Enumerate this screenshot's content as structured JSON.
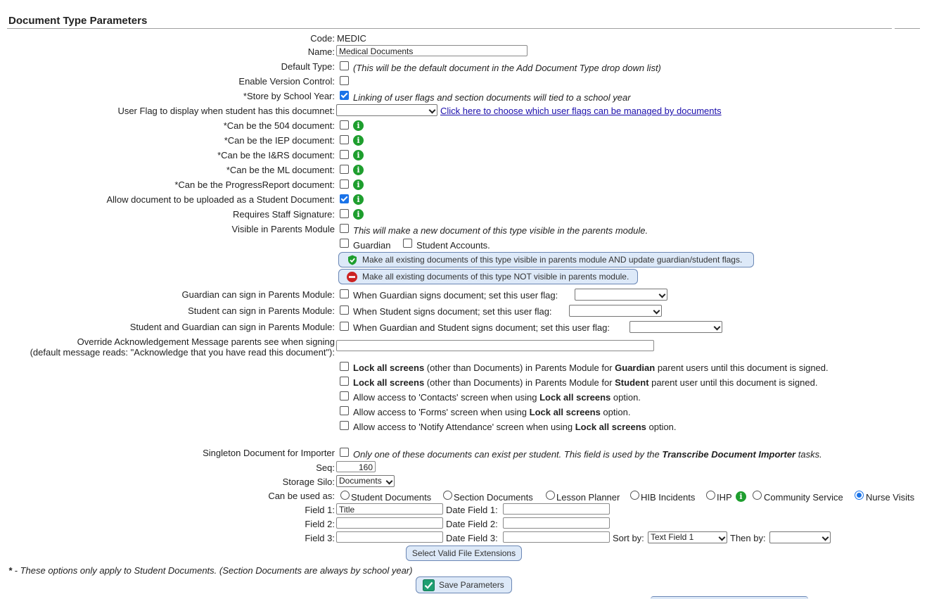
{
  "page_title": "Document Type Parameters",
  "code": {
    "label": "Code:",
    "value": "MEDIC"
  },
  "name": {
    "label": "Name:",
    "value": "Medical Documents"
  },
  "default_type": {
    "label": "Default Type:",
    "note": "(This will be the default document in the Add Document Type drop down list)",
    "checked": false
  },
  "version_control": {
    "label": "Enable Version Control:",
    "checked": false
  },
  "school_year": {
    "label": "*Store by School Year:",
    "note": "Linking of user flags and section documents will tied to a school year",
    "checked": true
  },
  "user_flag": {
    "label": "User Flag to display when student has this documnet:",
    "value": "",
    "link": "Click here to choose which user flags can be managed by documents"
  },
  "options": [
    {
      "label": "*Can be the 504 document:",
      "checked": false
    },
    {
      "label": "*Can be the IEP document:",
      "checked": false
    },
    {
      "label": "*Can be the I&RS document:",
      "checked": false
    },
    {
      "label": "*Can be the ML document:",
      "checked": false
    },
    {
      "label": "*Can be the ProgressReport document:",
      "checked": false
    },
    {
      "label": "Allow document to be uploaded as a Student Document:",
      "checked": true
    },
    {
      "label": "Requires Staff Signature:",
      "checked": false
    }
  ],
  "parents_module": {
    "label": "Visible in Parents Module",
    "note": "This will make a new document of this type visible in the parents module.",
    "guardian": "Guardian",
    "student_accounts": "Student Accounts.",
    "make_visible": "Make all existing documents of this type visible in parents module AND update guardian/student flags.",
    "make_not_visible": "Make all existing documents of this type NOT visible in parents module."
  },
  "signing": [
    {
      "label": "Guardian can sign in Parents Module:",
      "text": "When Guardian signs document; set this user flag:"
    },
    {
      "label": "Student can sign in Parents Module:",
      "text": "When Student signs document; set this user flag:"
    },
    {
      "label": "Student and Guardian can sign in Parents Module:",
      "text": "When Guardian and Student signs document; set this user flag:"
    }
  ],
  "override": {
    "label1": "Override Acknowledgement Message parents see when signing",
    "label2": "(default message reads: \"Acknowledge that you have read this document\"):",
    "value": ""
  },
  "lock_guardian": {
    "b1": "Lock all screens",
    "t1": " (other than Documents) in Parents Module for ",
    "b2": "Guardian",
    "t2": " parent users until this document is signed."
  },
  "lock_student": {
    "b1": "Lock all screens",
    "t1": " (other than Documents) in Parents Module for ",
    "b2": "Student",
    "t2": " parent user until this document is signed."
  },
  "access": [
    {
      "pre": "Allow access to 'Contacts' screen when using ",
      "bold": "Lock all screens",
      "post": " option."
    },
    {
      "pre": "Allow access to 'Forms' screen when using ",
      "bold": "Lock all screens",
      "post": " option."
    },
    {
      "pre": "Allow access to 'Notify Attendance' screen when using ",
      "bold": "Lock all screens",
      "post": " option."
    }
  ],
  "singleton": {
    "label": "Singleton Document for Importer",
    "note_pre": "Only one of these documents can exist per student. This field is used by the ",
    "note_bold": "Transcribe Document Importer",
    "note_post": " tasks."
  },
  "seq": {
    "label": "Seq:",
    "value": "160"
  },
  "storage": {
    "label": "Storage Silo:",
    "value": "Documents"
  },
  "used_as": {
    "label": "Can be used as:",
    "options": [
      "Student Documents",
      "Section Documents",
      "Lesson Planner",
      "HIB Incidents",
      "IHP",
      "Community Service",
      "Nurse Visits"
    ],
    "selected": "Nurse Visits"
  },
  "fields": {
    "field1": {
      "label": "Field 1:",
      "value": "Title"
    },
    "field2": {
      "label": "Field 2:",
      "value": ""
    },
    "field3": {
      "label": "Field 3:",
      "value": ""
    },
    "date1": {
      "label": "Date Field 1:",
      "value": ""
    },
    "date2": {
      "label": "Date Field 2:",
      "value": ""
    },
    "date3": {
      "label": "Date Field 3:",
      "value": ""
    },
    "sort_label": "Sort by:",
    "sort_value": "Text Field 1",
    "then_label": "Then by:",
    "then_value": ""
  },
  "file_ext_button": "Select Valid File Extensions",
  "footnote": {
    "star": "*",
    "text": " - These options only apply to Student Documents. (Section Documents are always by school year)"
  },
  "save_button": "Save Parameters",
  "colors": {
    "info": "#1e9e2e",
    "check": "#1a73e8",
    "pill_bg": "#dde9f8",
    "stop": "#cc2222"
  }
}
